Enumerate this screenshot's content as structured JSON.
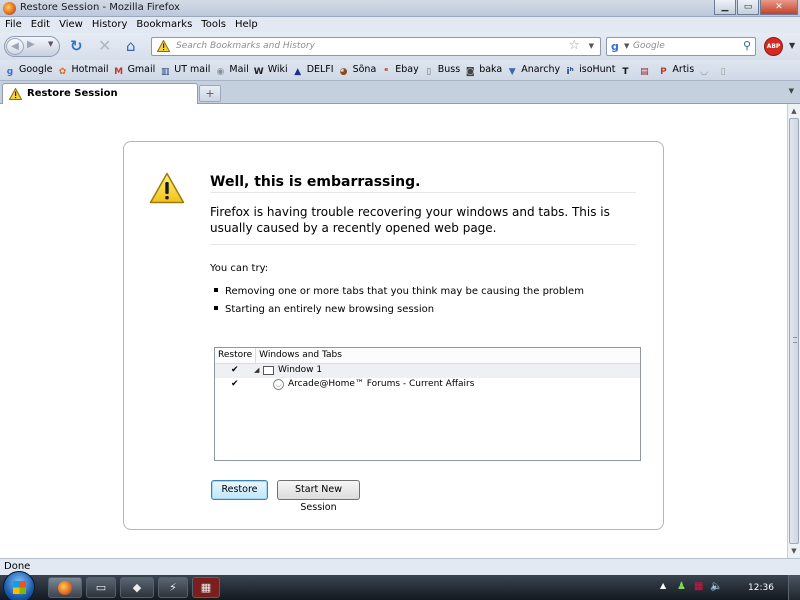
{
  "window": {
    "title": "Restore Session - Mozilla Firefox"
  },
  "menu": [
    "File",
    "Edit",
    "View",
    "History",
    "Bookmarks",
    "Tools",
    "Help"
  ],
  "urlbar": {
    "placeholder": "Search Bookmarks and History"
  },
  "searchbar": {
    "placeholder": "Google"
  },
  "bookmarks": [
    {
      "label": "Google",
      "icon": "g-icon",
      "glyph": "g",
      "color": "#3b6fd4"
    },
    {
      "label": "Hotmail",
      "icon": "butterfly-icon",
      "glyph": "✿",
      "color": "#e06a1a"
    },
    {
      "label": "Gmail",
      "icon": "gmail-icon",
      "glyph": "M",
      "color": "#c23a2b"
    },
    {
      "label": "UT mail",
      "icon": "building-icon",
      "glyph": "▥",
      "color": "#1d3f7a"
    },
    {
      "label": "Mail",
      "icon": "globe-icon",
      "glyph": "◉",
      "color": "#8a8f96"
    },
    {
      "label": "Wiki",
      "icon": "wikipedia-icon",
      "glyph": "W",
      "color": "#222"
    },
    {
      "label": "DELFI",
      "icon": "delfi-icon",
      "glyph": "▲",
      "color": "#1d2f8a"
    },
    {
      "label": "Sõna",
      "icon": "sona-icon",
      "glyph": "◕",
      "color": "#8a4a1a"
    },
    {
      "label": "Ebay",
      "icon": "ebay-icon",
      "glyph": "ᵉ",
      "color": "#d12b22"
    },
    {
      "label": "Buss",
      "icon": "page-icon",
      "glyph": "▯",
      "color": "#777"
    },
    {
      "label": "baka",
      "icon": "baka-icon",
      "glyph": "◙",
      "color": "#444"
    },
    {
      "label": "Anarchy",
      "icon": "anarchy-icon",
      "glyph": "▼",
      "color": "#3a6aa8"
    },
    {
      "label": "isoHunt",
      "icon": "isohunt-icon",
      "glyph": "iʰ",
      "color": "#1d3f7a"
    },
    {
      "label": "",
      "icon": "t-icon",
      "glyph": "T",
      "color": "#111"
    },
    {
      "label": "",
      "icon": "tabs-icon",
      "glyph": "▤",
      "color": "#aa2222"
    },
    {
      "label": "Artis",
      "icon": "p-icon",
      "glyph": "P",
      "color": "#c23a2b"
    },
    {
      "label": "",
      "icon": "feed-icon",
      "glyph": "◡",
      "color": "#888"
    },
    {
      "label": "",
      "icon": "page-icon",
      "glyph": "▯",
      "color": "#999"
    }
  ],
  "tab": {
    "label": "Restore Session",
    "new_tab": "+"
  },
  "dialog": {
    "heading": "Well, this is embarrassing.",
    "intro": "Firefox is having trouble recovering your windows and tabs. This is usually caused by a recently opened web page.",
    "try_label": "You can try:",
    "suggestions": [
      "Removing one or more tabs that you think may be causing the problem",
      "Starting an entirely new browsing session"
    ],
    "tree": {
      "col_restore": "Restore",
      "col_windows": "Windows and Tabs",
      "window_label": "Window 1",
      "tab_label": "Arcade@Home™ Forums - Current Affairs",
      "check": "✔"
    },
    "restore_button": "Restore",
    "new_session_button": "Start New Session"
  },
  "status": {
    "text": "Done"
  },
  "taskbar": {
    "clock": "12:36"
  }
}
